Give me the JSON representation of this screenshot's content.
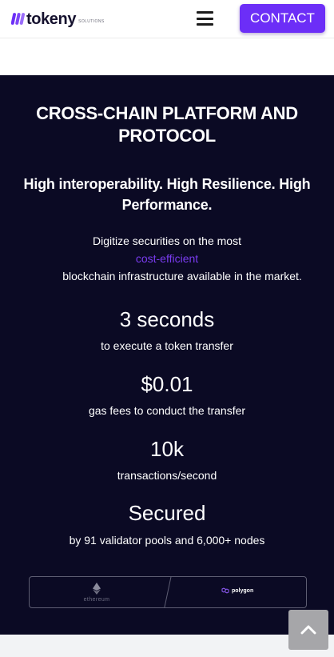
{
  "header": {
    "logo_word": "tokeny",
    "logo_sub": "SOLUTIONS",
    "menu_icon": "hamburger-menu-icon",
    "contact_label": "CONTACT"
  },
  "hero": {
    "title": "CROSS-CHAIN PLATFORM AND PROTOCOL",
    "subtitle": "High interoperability. High Resilience. High Performance.",
    "description_line1": "Digitize securities on the most",
    "description_highlight": "cost-efficient",
    "description_line3": "blockchain infrastructure available in the market."
  },
  "stats": [
    {
      "value": "3 seconds",
      "label": "to execute a token transfer"
    },
    {
      "value": "$0.01",
      "label": "gas fees to conduct the transfer"
    },
    {
      "value": "10k",
      "label": "transactions/second"
    },
    {
      "value": "Secured",
      "label": "by 91 validator pools and 6,000+ nodes"
    }
  ],
  "partners": {
    "ethereum": "ethereum",
    "polygon": "polygon"
  },
  "colors": {
    "brand_purple": "#6c2ef7",
    "hero_background": "#0b0a24",
    "highlight": "#7a3cf0"
  },
  "scroll_top_icon": "chevron-up-icon"
}
